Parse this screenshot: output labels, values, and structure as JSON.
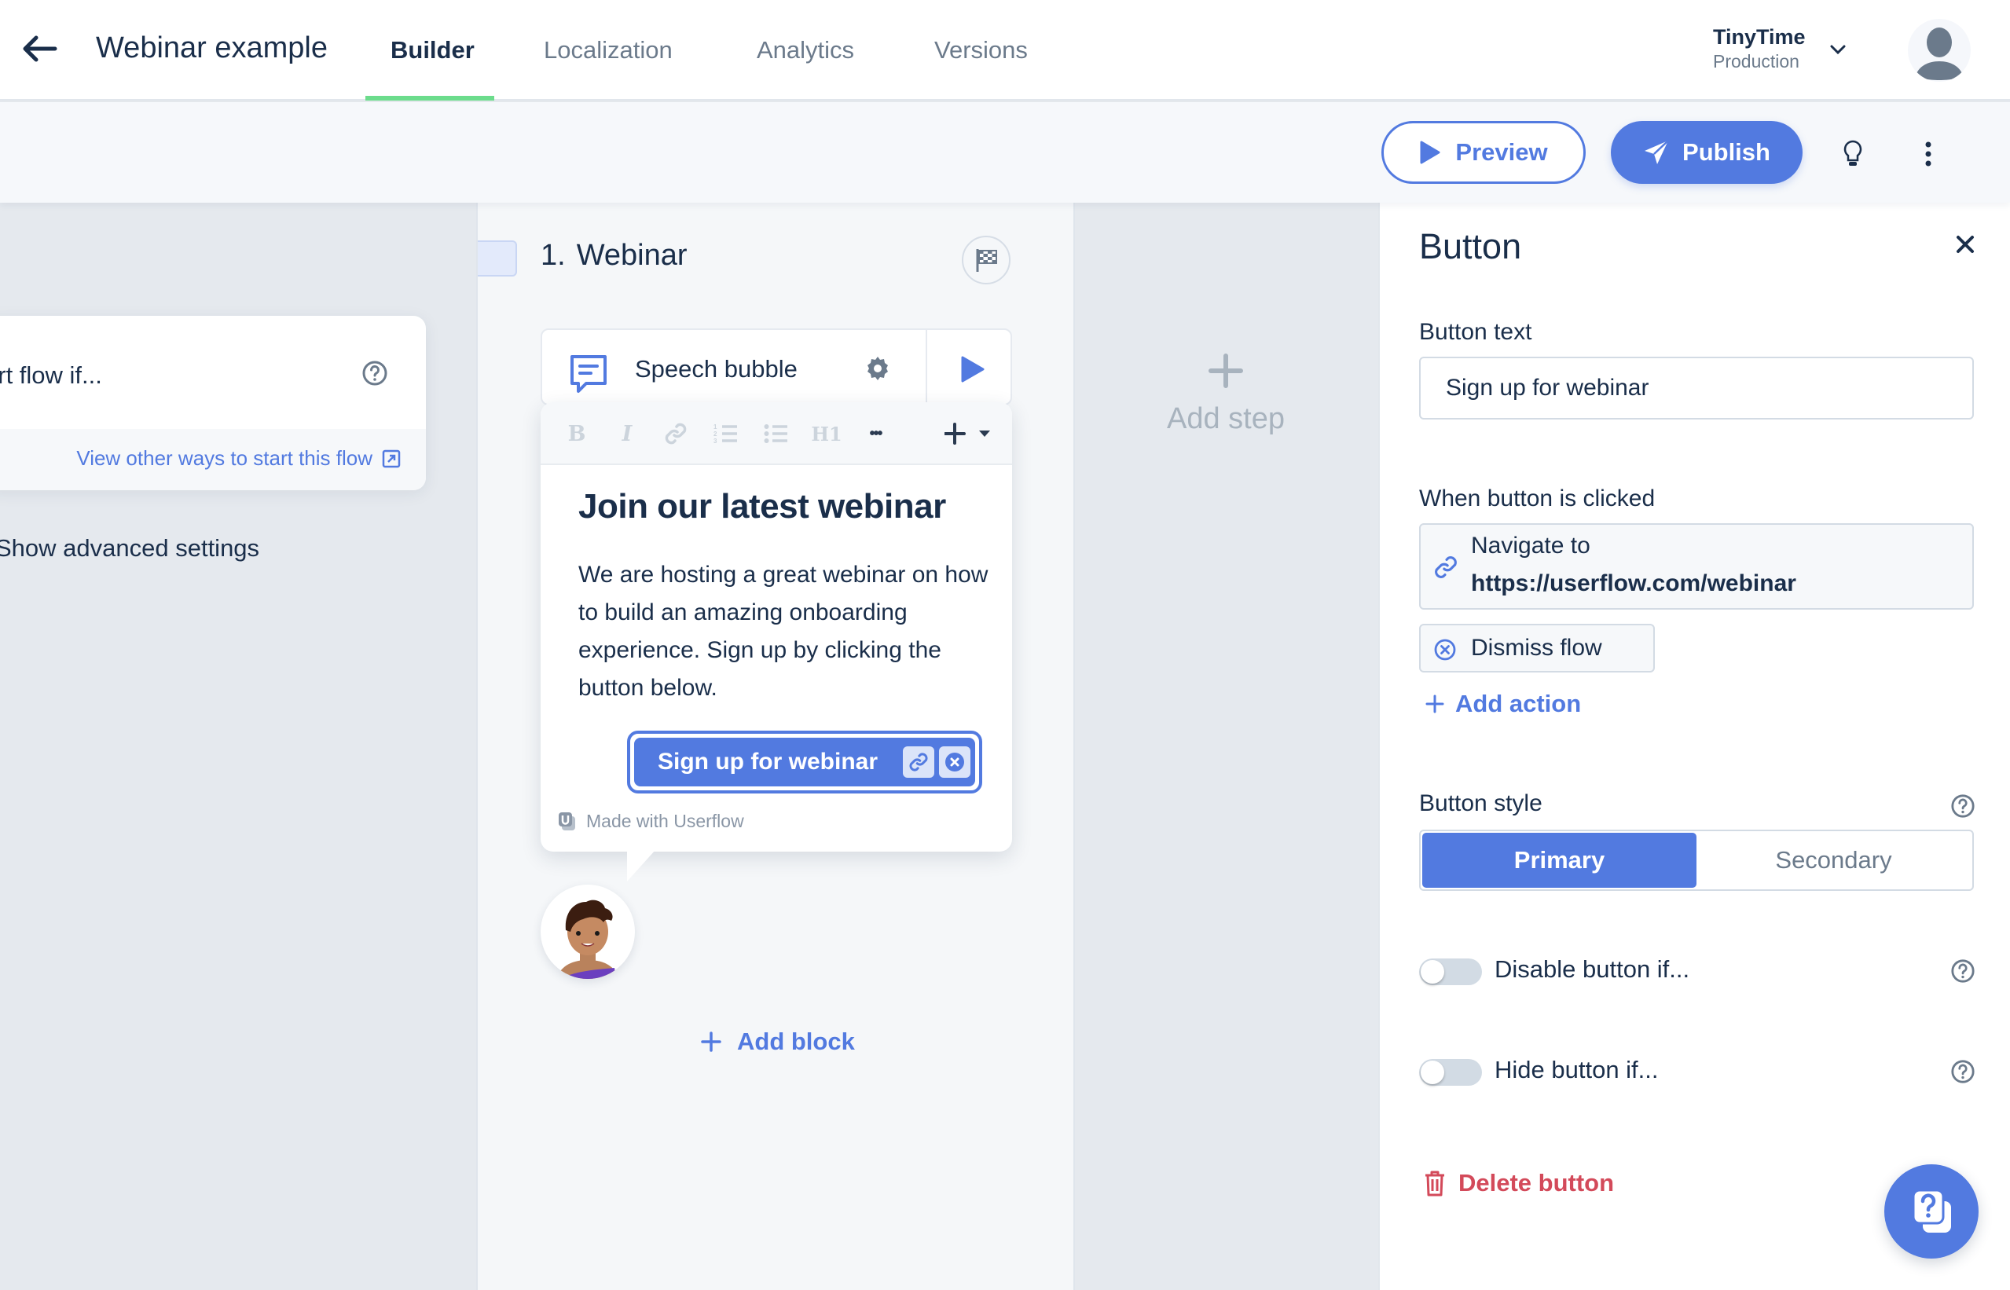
{
  "topnav": {
    "title": "Webinar example",
    "tabs": [
      {
        "label": "Builder",
        "active": true
      },
      {
        "label": "Localization",
        "active": false
      },
      {
        "label": "Analytics",
        "active": false
      },
      {
        "label": "Versions",
        "active": false
      }
    ],
    "workspace": {
      "name": "TinyTime",
      "environment": "Production"
    }
  },
  "toolbar": {
    "preview_label": "Preview",
    "publish_label": "Publish",
    "icons": [
      "lightbulb-icon",
      "more-vertical-icon"
    ]
  },
  "left_panel": {
    "trigger_title": "art flow if...",
    "trigger_link": "View other ways to start this flow",
    "advanced_settings": "Show advanced settings"
  },
  "step": {
    "number": "1.",
    "name": "Webinar",
    "block": {
      "type_label": "Speech bubble"
    },
    "rte_toolbar": [
      "B",
      "I",
      "link",
      "ordered-list",
      "bullet-list",
      "H1",
      "•••",
      "+"
    ],
    "bubble": {
      "heading": "Join our latest webinar",
      "body": "We are hosting a great webinar on how to build an amazing onboarding experience. Sign up by clicking the button below.",
      "button_label": "Sign up for webinar",
      "branding": "Made with Userflow"
    },
    "add_block_label": "Add block"
  },
  "add_step_label": "Add step",
  "right_panel": {
    "title": "Button",
    "button_text_label": "Button text",
    "button_text_value": "Sign up for webinar",
    "when_clicked_label": "When button is clicked",
    "actions": [
      {
        "title": "Navigate to",
        "detail": "https://userflow.com/webinar",
        "icon": "link-icon"
      },
      {
        "title": "Dismiss flow",
        "icon": "dismiss-icon"
      }
    ],
    "add_action_label": "Add action",
    "button_style_label": "Button style",
    "style_options": [
      {
        "label": "Primary",
        "selected": true
      },
      {
        "label": "Secondary",
        "selected": false
      }
    ],
    "toggles": [
      {
        "label": "Disable button if...",
        "on": false
      },
      {
        "label": "Hide button if...",
        "on": false
      }
    ],
    "delete_label": "Delete button"
  },
  "colors": {
    "accent": "#527ae0",
    "tab_indicator": "#6cdc8c",
    "danger": "#d34a5a",
    "text": "#1a2e4a",
    "muted": "#6b7a8b"
  }
}
